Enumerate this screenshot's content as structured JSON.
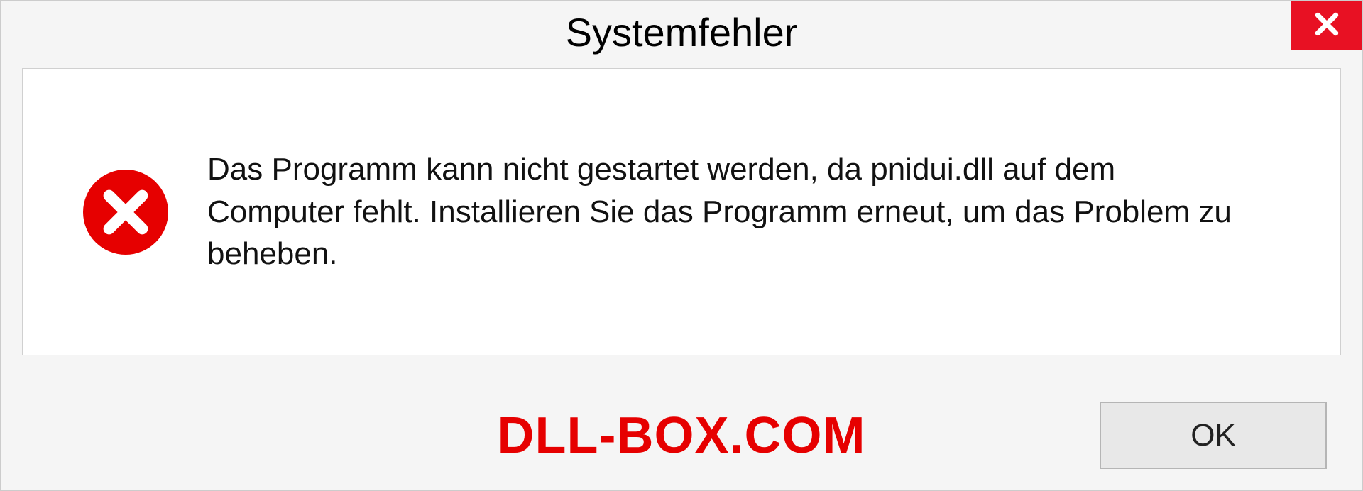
{
  "window": {
    "title": "Systemfehler"
  },
  "dialog": {
    "message": "Das Programm kann nicht gestartet werden, da pnidui.dll auf dem Computer fehlt. Installieren Sie das Programm erneut, um das Problem zu beheben."
  },
  "footer": {
    "watermark": "DLL-BOX.COM",
    "ok_label": "OK"
  }
}
